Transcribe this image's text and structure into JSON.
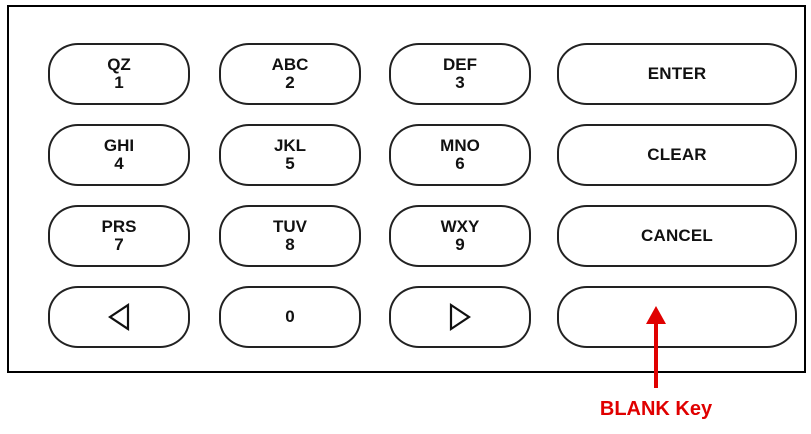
{
  "keypad": {
    "keys": {
      "k1": {
        "letters": "QZ",
        "digit": "1"
      },
      "k2": {
        "letters": "ABC",
        "digit": "2"
      },
      "k3": {
        "letters": "DEF",
        "digit": "3"
      },
      "k4": {
        "letters": "GHI",
        "digit": "4"
      },
      "k5": {
        "letters": "JKL",
        "digit": "5"
      },
      "k6": {
        "letters": "MNO",
        "digit": "6"
      },
      "k7": {
        "letters": "PRS",
        "digit": "7"
      },
      "k8": {
        "letters": "TUV",
        "digit": "8"
      },
      "k9": {
        "letters": "WXY",
        "digit": "9"
      },
      "k0": {
        "digit": "0"
      }
    },
    "enter_label": "ENTER",
    "clear_label": "CLEAR",
    "cancel_label": "CANCEL",
    "blank_label": "",
    "left_icon": "left-triangle-icon",
    "right_icon": "right-triangle-icon"
  },
  "callout": {
    "label": "BLANK Key",
    "color": "#e00000"
  }
}
